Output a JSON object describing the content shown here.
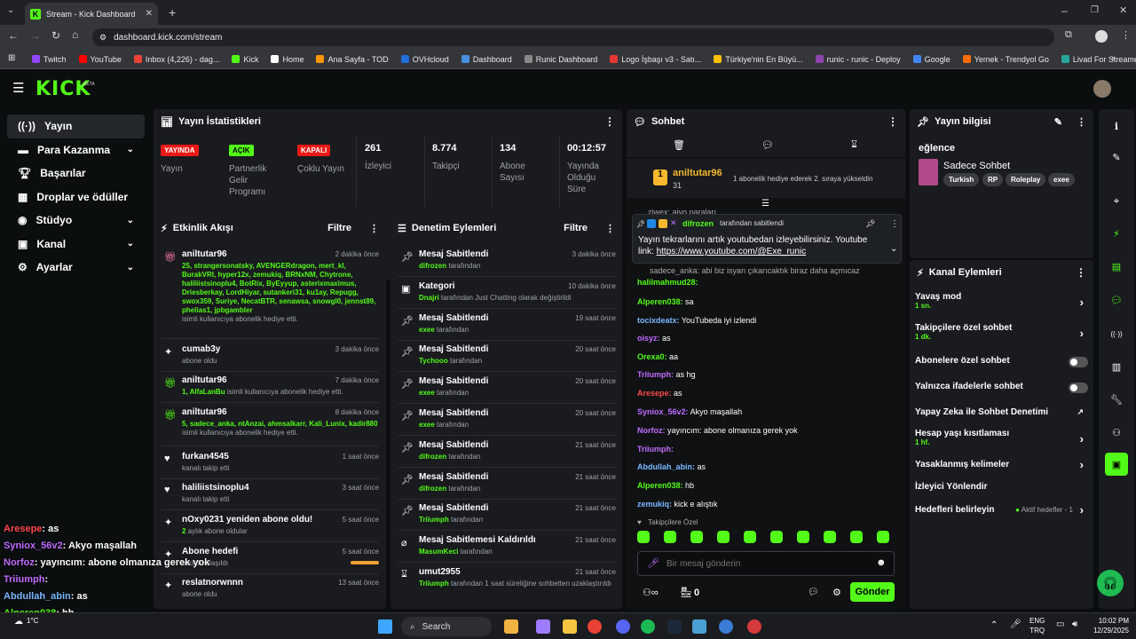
{
  "browser": {
    "tab_title": "Stream - Kick Dashboard",
    "url": "dashboard.kick.com/stream",
    "bookmarks": [
      "Twitch",
      "YouTube",
      "Inbox (4,226) - dag...",
      "Kick",
      "Home",
      "Ana Sayfa - TOD",
      "OVHcloud",
      "Dashboard",
      "Runic Dashboard",
      "Logo İşbaşı v3 - Satı...",
      "Türkiye'nin En Büyü...",
      "runic - runic - Deploy",
      "Google",
      "Yemek - Trendyol Go",
      "Livad For Streamers"
    ]
  },
  "app": {
    "logo": "KICK",
    "logo_beta": "BETA",
    "sidebar": [
      "Yayın",
      "Para Kazanma",
      "Başarılar",
      "Droplar ve ödüller",
      "Stüdyo",
      "Kanal",
      "Ayarlar"
    ]
  },
  "stats": {
    "title": "Yayın İstatistikleri",
    "yayin_badge": "YAYINDA",
    "yayin_label": "Yayın",
    "partner_badge": "AÇIK",
    "partner_label": "Partnerlik Gelir Programı",
    "multi_badge": "KAPALI",
    "multi_label": "Çoklu Yayın",
    "viewers": "261",
    "viewers_label": "İzleyici",
    "followers": "8.774",
    "followers_label": "Takipçi",
    "subs": "134",
    "subs_label": "Abone Sayısı",
    "duration": "00:12:57",
    "duration_label": "Yayında Olduğu Süre"
  },
  "activity": {
    "title": "Etkinlik Akışı",
    "filter": "Filtre",
    "items": [
      {
        "name": "aniltutar96",
        "time": "2 dakika önce",
        "hl": "25, strangersonatsky, AVENGERdragon, mert_kl, BurakVRI, hyper12x, zemukiq, BRNxNM, Chytrone, haliliistsinoplu4, BotRix, ByEyyup, asterixmaximus, Driesberkay, LordHiyar, sutankeri31, ku1ay, Repugg, swox359, Suriye, NecatBTR, senawsa, snowgl0, jennst89, phelias1, jpbgambler",
        "desc": "isimli kullanıcıya abonelik hediye etti."
      },
      {
        "name": "cumab3y",
        "time": "3 dakika önce",
        "hl": "",
        "desc": "abone oldu"
      },
      {
        "name": "aniltutar96",
        "time": "7 dakika önce",
        "hl": "1, AlfaLanBu",
        "desc": "isimli kullanıcıya abonelik hediye etti."
      },
      {
        "name": "aniltutar96",
        "time": "8 dakika önce",
        "hl": "5, sadece_anka, ntAnzai, ahmsalkarr, Kali_Lunix, kadir880",
        "desc": "isimli kullanıcıya abonelik hediye etti."
      },
      {
        "name": "furkan4545",
        "time": "1 saat önce",
        "hl": "",
        "desc": "kanalı takip etti"
      },
      {
        "name": "haliliistsinoplu4",
        "time": "3 saat önce",
        "hl": "",
        "desc": "kanalı takip etti"
      },
      {
        "name": "nOxy0231 yeniden abone oldu!",
        "time": "5 saat önce",
        "hl": "2",
        "desc": "aylık abone oldular"
      },
      {
        "name": "Abone hedefi",
        "time": "5 saat önce",
        "hl": "",
        "desc": "hedefe ulaşıldı"
      },
      {
        "name": "reslatnorwnnn",
        "time": "13 saat önce",
        "hl": "",
        "desc": "abone oldu"
      }
    ]
  },
  "moderation": {
    "title": "Denetim Eylemleri",
    "filter": "Filtre",
    "items": [
      {
        "title": "Mesaj Sabitlendi",
        "time": "3 dakika önce",
        "who": "difrozen",
        "rest": "tarafından"
      },
      {
        "title": "Kategori",
        "time": "10 dakika önce",
        "who": "Dnajri",
        "rest": "tarafından Just Chatting olarak değiştirildi"
      },
      {
        "title": "Mesaj Sabitlendi",
        "time": "19 saat önce",
        "who": "exee",
        "rest": "tarafından"
      },
      {
        "title": "Mesaj Sabitlendi",
        "time": "20 saat önce",
        "who": "Tychooo",
        "rest": "tarafından"
      },
      {
        "title": "Mesaj Sabitlendi",
        "time": "20 saat önce",
        "who": "exee",
        "rest": "tarafından"
      },
      {
        "title": "Mesaj Sabitlendi",
        "time": "20 saat önce",
        "who": "exee",
        "rest": "tarafından"
      },
      {
        "title": "Mesaj Sabitlendi",
        "time": "21 saat önce",
        "who": "difrozen",
        "rest": "tarafından"
      },
      {
        "title": "Mesaj Sabitlendi",
        "time": "21 saat önce",
        "who": "difrozen",
        "rest": "tarafından"
      },
      {
        "title": "Mesaj Sabitlendi",
        "time": "21 saat önce",
        "who": "Triiumph",
        "rest": "tarafından"
      },
      {
        "title": "Mesaj Sabitlemesi Kaldırıldı",
        "time": "21 saat önce",
        "who": "MasumKeci",
        "rest": "tarafından"
      },
      {
        "title": "umut2955",
        "time": "21 saat önce",
        "who": "Triiumph",
        "rest": "tarafından 1 saat süreliğine sohbetten uzaklaştırıldı"
      }
    ]
  },
  "chat": {
    "title": "Sohbet",
    "gift_user": "aniltutar96",
    "gift_count": "31",
    "gift_text": "1 abonelik hediye ederek 2. sıraya yükseldin",
    "pinned_by": "difrozen",
    "pinned_by_rest": "tarafından sabitlendi",
    "pinned_msg": "Yayın tekrarlarını artık youtubedan izleyebilirsiniz. Youtube link:",
    "pinned_link": "https://www.youtube.com/@Exe_runic",
    "peek_top": "ziwex: aiyo paraları",
    "peek_under": "sadece_anka: abi biz isyan çıkarıcaktık biraz daha açmıcaz",
    "messages": [
      {
        "user": "halilmahmud28:",
        "text": "",
        "color": "#53fc18"
      },
      {
        "user": "Alperen038:",
        "text": "sa",
        "color": "#53fc18"
      },
      {
        "user": "tocixdeatx:",
        "text": "YouTubeda iyi izlendi",
        "color": "#7ab8ff"
      },
      {
        "user": "oisyz:",
        "text": "as",
        "color": "#c06cff"
      },
      {
        "user": "Orexa0:",
        "text": "aa",
        "color": "#53fc18"
      },
      {
        "user": "Triiumph:",
        "text": "as hg",
        "color": "#c06cff"
      },
      {
        "user": "Aresepe:",
        "text": "as",
        "color": "#ff4b4b"
      },
      {
        "user": "Syniox_56v2:",
        "text": "Akyo maşallah",
        "color": "#c06cff"
      },
      {
        "user": "Norfoz:",
        "text": "yayıncım: abone olmanıza gerek yok",
        "color": "#c06cff"
      },
      {
        "user": "Triiumph:",
        "text": "",
        "color": "#c06cff"
      },
      {
        "user": "Abdullah_abin:",
        "text": "as",
        "color": "#7ab8ff"
      },
      {
        "user": "Alperen038:",
        "text": "hb",
        "color": "#53fc18"
      },
      {
        "user": "zemukiq:",
        "text": "kick e alıştık",
        "color": "#7ab8ff"
      }
    ],
    "emote_label": "Takipçilere Özel",
    "placeholder": "Bir mesaj gönderin",
    "count": "0",
    "send": "Gönder"
  },
  "info": {
    "title": "Yayın bilgisi",
    "stream_title": "eğlence",
    "category": "Sadece Sohbet",
    "tags": [
      "Turkish",
      "RP",
      "Roleplay",
      "exee"
    ]
  },
  "channel_actions": {
    "title": "Kanal Eylemleri",
    "slow": "Yavaş mod",
    "slow_val": "1 sn.",
    "followers_only": "Takipçilere özel sohbet",
    "followers_only_val": "1 dk.",
    "subs_only": "Abonelere özel sohbet",
    "emote_only": "Yalnızca ifadelerle sohbet",
    "ai": "Yapay Zeka ile Sohbet Denetimi",
    "age": "Hesap yaşı kısıtlaması",
    "age_val": "1 hf.",
    "banned": "Yasaklanmış kelimeler",
    "redirect": "İzleyici Yönlendir",
    "goals": "Hedefleri belirleyin",
    "goals_status": "Aktif hedefler - 1"
  },
  "overlay": [
    {
      "user": "Aresepe",
      "text": ": as",
      "color": "#ff4b4b"
    },
    {
      "user": "Syniox_56v2",
      "text": ": Akyo maşallah",
      "color": "#c06cff"
    },
    {
      "user": "Norfoz",
      "text": ": yayıncım: abone olmanıza gerek yok",
      "color": "#c06cff"
    },
    {
      "user": "Triiumph",
      "text": ":",
      "color": "#c06cff"
    },
    {
      "user": "Abdullah_abin",
      "text": ": as",
      "color": "#7ab8ff"
    },
    {
      "user": "Alperen038",
      "text": ": hb",
      "color": "#53fc18"
    },
    {
      "user": "zemukiq",
      "text": ": kick e alıştık",
      "color": "#7ab8ff"
    }
  ],
  "taskbar": {
    "temp": "1°C",
    "search": "Search",
    "lang1": "ENG",
    "lang2": "TRQ",
    "time": "10:02 PM",
    "date": "12/29/2025"
  }
}
